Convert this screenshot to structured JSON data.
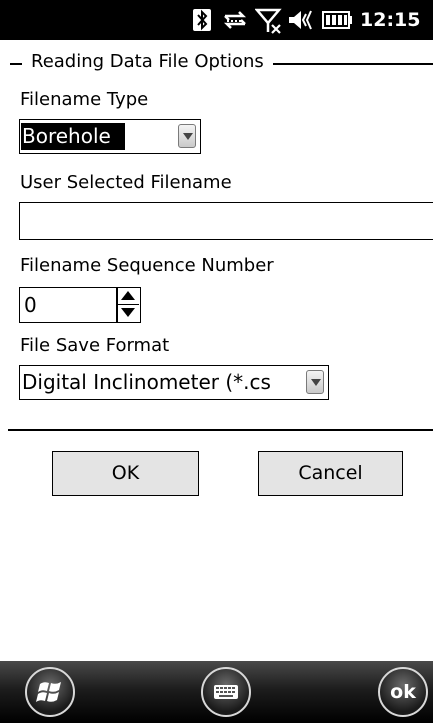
{
  "status_bar": {
    "clock": "12:15",
    "icons": [
      "bluetooth-icon",
      "data-sync-icon",
      "no-signal-icon",
      "volume-icon",
      "battery-icon"
    ]
  },
  "group": {
    "title": "Reading Data File Options"
  },
  "filename_type": {
    "label": "Filename Type",
    "value": "Borehole"
  },
  "user_filename": {
    "label": "User Selected Filename",
    "value": ""
  },
  "sequence": {
    "label": "Filename Sequence Number",
    "value": "0"
  },
  "save_format": {
    "label": "File Save Format",
    "value": "Digital Inclinometer (*.cs"
  },
  "buttons": {
    "ok": "OK",
    "cancel": "Cancel"
  },
  "taskbar": {
    "ok_label": "ok",
    "icons": [
      "windows-start-icon",
      "keyboard-icon"
    ]
  }
}
